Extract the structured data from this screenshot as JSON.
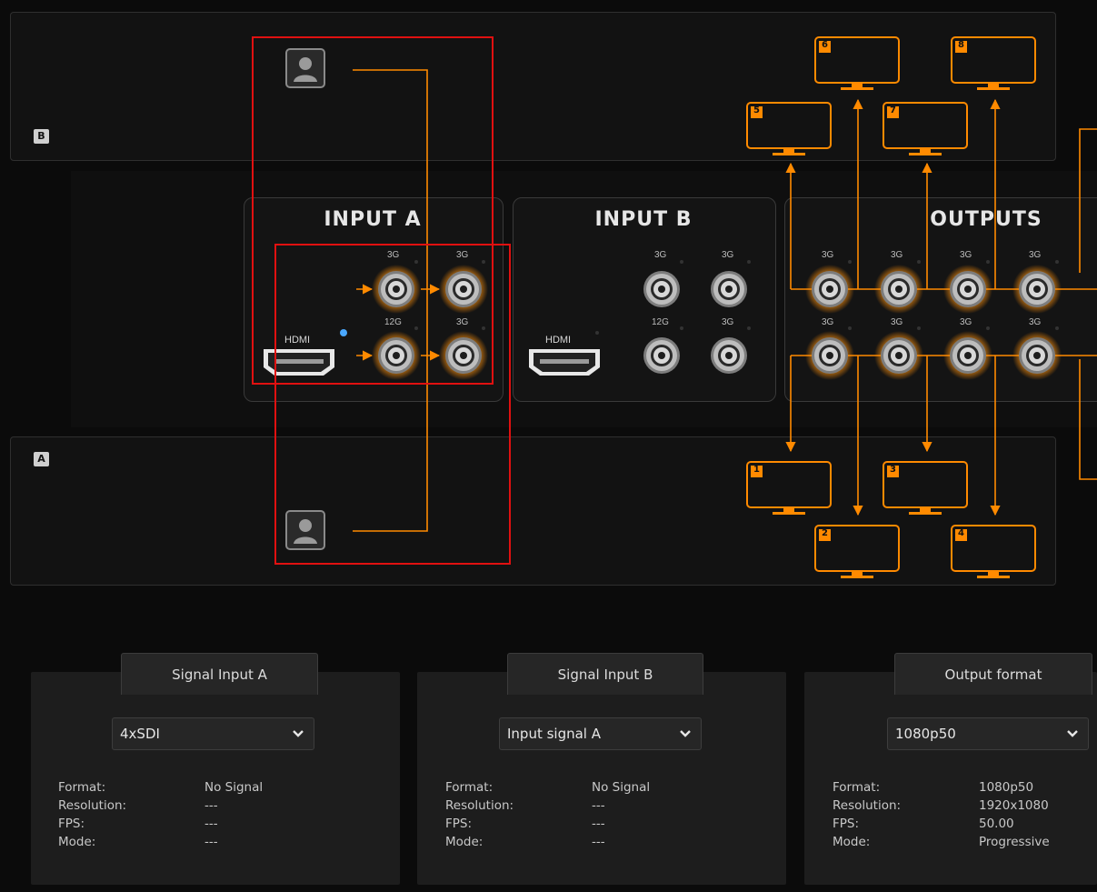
{
  "channels": {
    "top": "B",
    "bottom": "A"
  },
  "panels": {
    "input_a": {
      "title": "INPUT A",
      "hdmi": "HDMI",
      "bnc": [
        "3G",
        "3G",
        "12G",
        "3G"
      ]
    },
    "input_b": {
      "title": "INPUT B",
      "hdmi": "HDMI",
      "bnc": [
        "3G",
        "3G",
        "12G",
        "3G"
      ]
    },
    "outputs": {
      "title": "OUTPUTS",
      "bnc": [
        "3G",
        "3G",
        "3G",
        "3G",
        "3G",
        "3G",
        "3G",
        "3G"
      ]
    }
  },
  "monitors": [
    "1",
    "2",
    "3",
    "4",
    "5",
    "6",
    "7",
    "8"
  ],
  "icons": {
    "user": "user-silhouette-icon",
    "monitor": "monitor-icon",
    "bnc": "bnc-connector-icon",
    "hdmi": "hdmi-port-icon",
    "dropdown": "chevron-down-icon"
  },
  "colors": {
    "accent": "#ff8a00",
    "highlight": "#e01010",
    "active_led": "#4aa8ff"
  },
  "settings": {
    "signal_a": {
      "tab": "Signal Input A",
      "selected": "4xSDI",
      "labels": [
        "Format:",
        "Resolution:",
        "FPS:",
        "Mode:"
      ],
      "values": [
        "No Signal",
        "---",
        "---",
        "---"
      ]
    },
    "signal_b": {
      "tab": "Signal Input B",
      "selected": "Input signal A",
      "labels": [
        "Format:",
        "Resolution:",
        "FPS:",
        "Mode:"
      ],
      "values": [
        "No Signal",
        "---",
        "---",
        "---"
      ]
    },
    "output": {
      "tab": "Output format",
      "selected": "1080p50",
      "labels": [
        "Format:",
        "Resolution:",
        "FPS:",
        "Mode:"
      ],
      "values": [
        "1080p50",
        "1920x1080",
        "50.00",
        "Progressive"
      ]
    }
  }
}
